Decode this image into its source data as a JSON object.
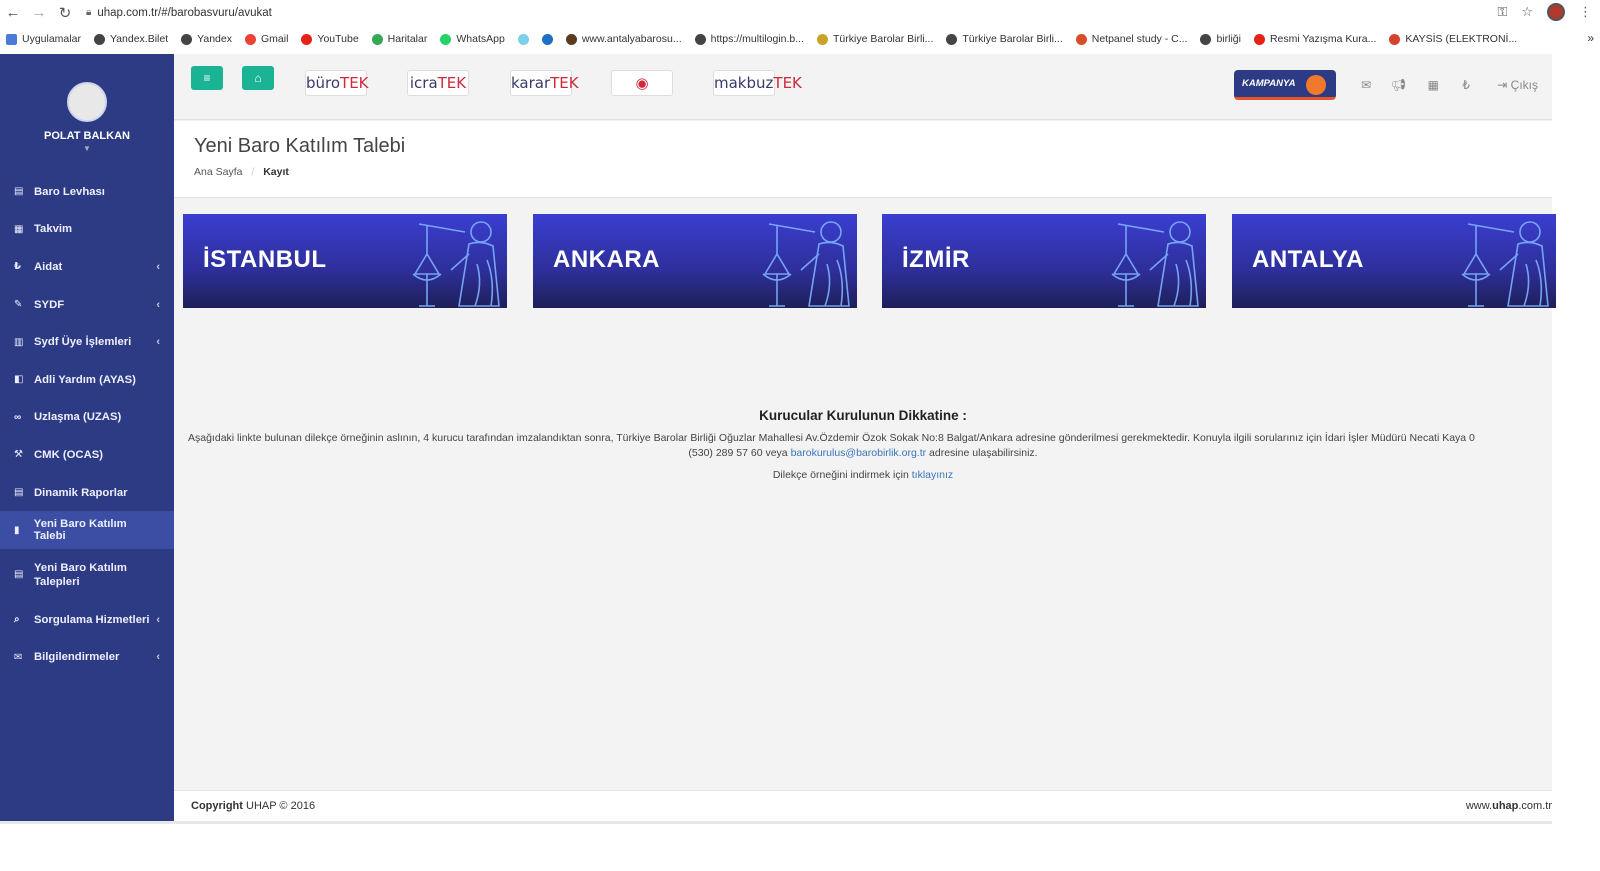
{
  "browser": {
    "url": "uhap.com.tr/#/barobasvuru/avukat",
    "bookmarks": [
      {
        "label": "Uygulamalar",
        "color": "#4a7bd6"
      },
      {
        "label": "Yandex.Bilet",
        "color": "#444"
      },
      {
        "label": "Yandex",
        "color": "#444"
      },
      {
        "label": "Gmail",
        "color": "#ea4335"
      },
      {
        "label": "YouTube",
        "color": "#e62117"
      },
      {
        "label": "Haritalar",
        "color": "#34a853"
      },
      {
        "label": "WhatsApp",
        "color": "#25d366"
      },
      {
        "label": "",
        "color": "#7ad0e8"
      },
      {
        "label": "",
        "color": "#1f6fc5"
      },
      {
        "label": "www.antalyabarosu...",
        "color": "#5a3a20"
      },
      {
        "label": "https://multilogin.b...",
        "color": "#444"
      },
      {
        "label": "Türkiye Barolar Birli...",
        "color": "#c9a227"
      },
      {
        "label": "Türkiye Barolar Birli...",
        "color": "#444"
      },
      {
        "label": "Netpanel study - C...",
        "color": "#d94c2a"
      },
      {
        "label": "birliği",
        "color": "#444"
      },
      {
        "label": "Resmi Yazışma Kura...",
        "color": "#e62117"
      },
      {
        "label": "KAYSİS (ELEKTRONİ...",
        "color": "#d4442c"
      }
    ]
  },
  "sidebar": {
    "user_name": "POLAT BALKAN",
    "items": [
      {
        "label": "Baro Levhası",
        "icon": "▤",
        "caret": false
      },
      {
        "label": "Takvim",
        "icon": "▦",
        "caret": false
      },
      {
        "label": "Aidat",
        "icon": "₺",
        "caret": true
      },
      {
        "label": "SYDF",
        "icon": "✎",
        "caret": true
      },
      {
        "label": "Sydf Üye İşlemleri",
        "icon": "▥",
        "caret": true
      },
      {
        "label": "Adli Yardım (AYAS)",
        "icon": "◧",
        "caret": false
      },
      {
        "label": "Uzlaşma (UZAS)",
        "icon": "∞",
        "caret": false
      },
      {
        "label": "CMK (OCAS)",
        "icon": "⚒",
        "caret": false
      },
      {
        "label": "Dinamik Raporlar",
        "icon": "▤",
        "caret": false
      },
      {
        "label": "Yeni Baro Katılım Talebi",
        "icon": "▮",
        "caret": false,
        "active": true
      },
      {
        "label": "Yeni Baro Katılım Talepleri",
        "icon": "▤",
        "caret": false,
        "tall": true
      },
      {
        "label": "Sorgulama Hizmetleri",
        "icon": "⌕",
        "caret": true
      },
      {
        "label": "Bilgilendirmeler",
        "icon": "✉",
        "caret": true
      }
    ]
  },
  "topbar": {
    "products": [
      {
        "a": "büro",
        "b": "TEK"
      },
      {
        "a": "icra",
        "b": "TEK"
      },
      {
        "a": "karar",
        "b": "TEK"
      },
      {
        "a": "",
        "b": "◉"
      },
      {
        "a": "makbuz",
        "b": "TEK"
      }
    ],
    "kampanya": "KAMPANYA",
    "logout": "Çıkış"
  },
  "page": {
    "title": "Yeni Baro Katılım Talebi",
    "breadcrumb_home": "Ana Sayfa",
    "breadcrumb_current": "Kayıt"
  },
  "cities": [
    "İSTANBUL",
    "ANKARA",
    "İZMİR",
    "ANTALYA"
  ],
  "notice": {
    "title": "Kurucular Kurulunun Dikkatine :",
    "body": "Aşağıdaki linkte bulunan dilekçe örneğinin aslının, 4 kurucu tarafından imzalandıktan sonra, Türkiye Barolar Birliği Oğuzlar Mahallesi Av.Özdemir Özok Sokak No:8 Balgat/Ankara adresine gönderilmesi gerekmektedir. Konuyla ilgili sorularınız için İdari İşler Müdürü Necati Kaya 0",
    "phone_text": "(530) 289 57 60 veya",
    "email": "barokurulus@barobirlik.org.tr",
    "after_email": "adresine ulaşabilirsiniz.",
    "download_text": "Dilekçe örneğini indirmek için",
    "download_link": "tıklayınız"
  },
  "footer": {
    "copyright_bold": "Copyright",
    "copyright_rest": "UHAP © 2016",
    "site_pre": "www.",
    "site_bold": "uhap",
    "site_post": ".com.tr"
  }
}
